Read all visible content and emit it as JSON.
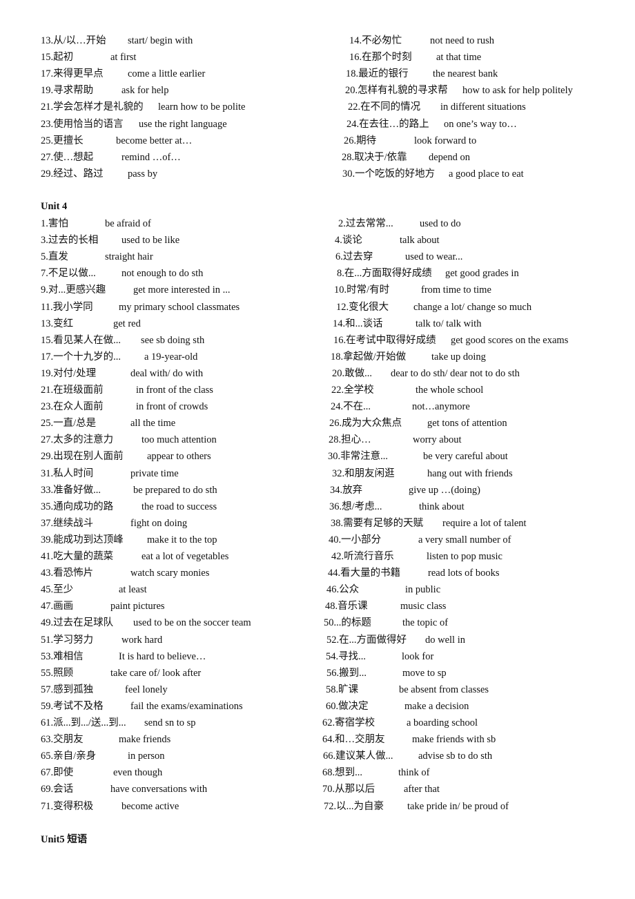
{
  "document": {
    "intro_rows": [
      {
        "left": {
          "cn": "13.从/以…开始",
          "en": "start/ begin with"
        },
        "right": {
          "cn": "14.不必匆忙",
          "en": "not need to rush"
        }
      },
      {
        "left": {
          "cn": "15.起初",
          "en": "at first"
        },
        "right": {
          "cn": "16.在那个时刻",
          "en": "at that time"
        }
      },
      {
        "left": {
          "cn": "17.来得更早点",
          "en": "come a little earlier"
        },
        "right": {
          "cn": "18.最近的银行",
          "en": "the nearest bank"
        }
      },
      {
        "left": {
          "cn": "19.寻求帮助",
          "en": "ask for help"
        },
        "right": {
          "cn": "20.怎样有礼貌的寻求帮",
          "en": "how to ask for help politely"
        }
      },
      {
        "left": {
          "cn": "21.学会怎样才是礼貌的",
          "en": "learn how to be polite"
        },
        "right": {
          "cn": "22.在不同的情况",
          "en": "in different situations"
        }
      },
      {
        "left": {
          "cn": "23.使用恰当的语言",
          "en": "use the right language"
        },
        "right": {
          "cn": "24.在去往…的路上",
          "en": "on one’s way to…"
        }
      },
      {
        "left": {
          "cn": "25.更擅长",
          "en": "become better at…"
        },
        "right": {
          "cn": "26.期待",
          "en": "look forward to"
        }
      },
      {
        "left": {
          "cn": "27.使…想起",
          "en": "remind …of…"
        },
        "right": {
          "cn": "28.取决于/依靠",
          "en": "depend on"
        }
      },
      {
        "left": {
          "cn": "29.经过、路过",
          "en": "pass by"
        },
        "right": {
          "cn": "30.一个吃饭的好地方",
          "en": "a good place to eat"
        }
      }
    ],
    "unit4": {
      "heading": "Unit 4",
      "rows": [
        {
          "left": {
            "cn": "1.害怕",
            "en": "be afraid of"
          },
          "right": {
            "cn": "2.过去常常...",
            "en": "used to do"
          }
        },
        {
          "left": {
            "cn": "3.过去的长相",
            "en": "used to be like"
          },
          "right": {
            "cn": "4.谈论",
            "en": "talk about"
          }
        },
        {
          "left": {
            "cn": "5.直发",
            "en": "straight hair"
          },
          "right": {
            "cn": "6.过去穿",
            "en": "used to wear..."
          }
        },
        {
          "left": {
            "cn": "7.不足以做...",
            "en": "not enough to do sth"
          },
          "right": {
            "cn": "8.在...方面取得好成绩",
            "en": "get good grades in"
          }
        },
        {
          "left": {
            "cn": "9.对...更感兴趣",
            "en": "get more interested in ..."
          },
          "right": {
            "cn": "10.时常/有时",
            "en": "from time to time"
          }
        },
        {
          "left": {
            "cn": "11.我小学同",
            "en": "my primary school classmates"
          },
          "right": {
            "cn": "12.变化很大",
            "en": "change a lot/ change so much"
          }
        },
        {
          "left": {
            "cn": "13.变红",
            "en": "get red"
          },
          "right": {
            "cn": "14.和...谈话",
            "en": "talk to/ talk with"
          }
        },
        {
          "left": {
            "cn": "15.看见某人在做...",
            "en": "see sb doing sth"
          },
          "right": {
            "cn": "16.在考试中取得好成绩",
            "en": "get good scores on the exams"
          }
        },
        {
          "left": {
            "cn": "17.一个十九岁的...",
            "en": "a 19-year-old"
          },
          "right": {
            "cn": "18.拿起做/开始做",
            "en": "take up doing"
          }
        },
        {
          "left": {
            "cn": "19.对付/处理",
            "en": "deal with/ do with"
          },
          "right": {
            "cn": "20.敢做...",
            "en": "dear to do sth/ dear not to do sth"
          }
        },
        {
          "left": {
            "cn": "21.在班级面前",
            "en": "in front of the class"
          },
          "right": {
            "cn": "22.全学校",
            "en": "the whole school"
          }
        },
        {
          "left": {
            "cn": "23.在众人面前",
            "en": "in front of crowds"
          },
          "right": {
            "cn": "24.不在...",
            "en": "not…anymore"
          }
        },
        {
          "left": {
            "cn": "25.一直/总是",
            "en": "all the time"
          },
          "right": {
            "cn": "26.成为大众焦点",
            "en": "get tons of attention"
          }
        },
        {
          "left": {
            "cn": "27.太多的注意力",
            "en": "too much attention"
          },
          "right": {
            "cn": "28.担心…",
            "en": "worry about"
          }
        },
        {
          "left": {
            "cn": "29.出现在别人面前",
            "en": "appear to others"
          },
          "right": {
            "cn": "30.非常注意...",
            "en": "be very careful about"
          }
        },
        {
          "left": {
            "cn": "31.私人时间",
            "en": "private time"
          },
          "right": {
            "cn": "32.和朋友闲逛",
            "en": "hang out with friends"
          }
        },
        {
          "left": {
            "cn": "33.准备好做...",
            "en": "be prepared to do sth"
          },
          "right": {
            "cn": "34.放弃",
            "en": "give up …(doing)"
          }
        },
        {
          "left": {
            "cn": "35.通向成功的路",
            "en": "the road to success"
          },
          "right": {
            "cn": "36.想/考虑...",
            "en": "think about"
          }
        },
        {
          "left": {
            "cn": "37.继续战斗",
            "en": "fight on doing"
          },
          "right": {
            "cn": "38.需要有足够的天赋",
            "en": "require a lot of talent"
          }
        },
        {
          "left": {
            "cn": "39.能成功到达顶峰",
            "en": "make it to the top"
          },
          "right": {
            "cn": "40.一小部分",
            "en": "a very small number of"
          }
        },
        {
          "left": {
            "cn": "41.吃大量的蔬菜",
            "en": "eat a lot of vegetables"
          },
          "right": {
            "cn": "42.听流行音乐",
            "en": "listen to pop music"
          }
        },
        {
          "left": {
            "cn": "43.看恐怖片",
            "en": "watch scary monies"
          },
          "right": {
            "cn": "44.看大量的书籍",
            "en": "read lots of books"
          }
        },
        {
          "left": {
            "cn": "45.至少",
            "en": "at least"
          },
          "right": {
            "cn": "46.公众",
            "en": "in public"
          }
        },
        {
          "left": {
            "cn": "47.画画",
            "en": "paint pictures"
          },
          "right": {
            "cn": "48.音乐课",
            "en": "music class"
          }
        },
        {
          "left": {
            "cn": "49.过去在足球队",
            "en": "used to be on the soccer team"
          },
          "right": {
            "cn": "50...的标题",
            "en": "the topic of"
          }
        },
        {
          "left": {
            "cn": "51.学习努力",
            "en": "work hard"
          },
          "right": {
            "cn": "52.在...方面做得好",
            "en": "do well in"
          }
        },
        {
          "left": {
            "cn": "53.难相信",
            "en": "It is hard to believe…"
          },
          "right": {
            "cn": "54.寻找...",
            "en": "look for"
          }
        },
        {
          "left": {
            "cn": "55.照顾",
            "en": "take care of/ look after"
          },
          "right": {
            "cn": "56.搬到...",
            "en": "move to sp"
          }
        },
        {
          "left": {
            "cn": "57.感到孤独",
            "en": "feel lonely"
          },
          "right": {
            "cn": "58.旷课",
            "en": "be absent from classes"
          }
        },
        {
          "left": {
            "cn": "59.考试不及格",
            "en": "fail the exams/examinations"
          },
          "right": {
            "cn": "60.做决定",
            "en": "make a decision"
          }
        },
        {
          "left": {
            "cn": "61.派...到.../送...到...",
            "en": "send sn to sp"
          },
          "right": {
            "cn": "62.寄宿学校",
            "en": "a boarding school"
          }
        },
        {
          "left": {
            "cn": "63.交朋友",
            "en": "make friends"
          },
          "right": {
            "cn": "64.和…交朋友",
            "en": "make friends with sb"
          }
        },
        {
          "left": {
            "cn": "65.亲自/亲身",
            "en": "in person"
          },
          "right": {
            "cn": "66.建议某人做...",
            "en": "advise sb to do sth"
          }
        },
        {
          "left": {
            "cn": "67.即使",
            "en": "even though"
          },
          "right": {
            "cn": "68.想到...",
            "en": "think of"
          }
        },
        {
          "left": {
            "cn": "69.会话",
            "en": "have conversations with"
          },
          "right": {
            "cn": "70.从那以后",
            "en": "after that"
          }
        },
        {
          "left": {
            "cn": "71.变得积极",
            "en": "become active"
          },
          "right": {
            "cn": "72.以...为自豪",
            "en": "take pride in/ be proud of"
          }
        }
      ]
    },
    "unit5": {
      "heading": "Unit5 短语"
    }
  }
}
